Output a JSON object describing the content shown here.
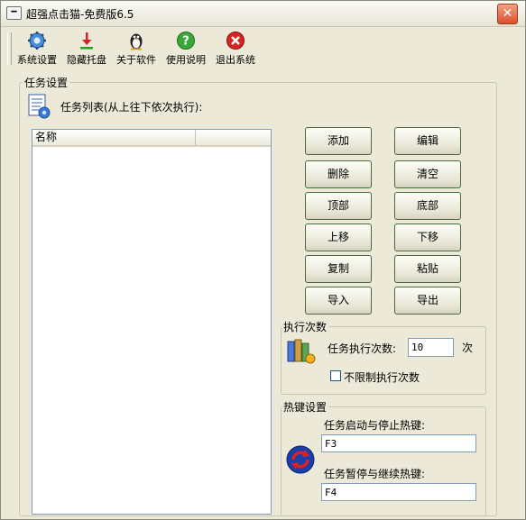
{
  "window": {
    "title": "超强点击猫-免费版6.5",
    "sysmenu_glyph": "━",
    "close_glyph": "✕"
  },
  "toolbar": {
    "items": [
      {
        "label": "系统设置",
        "icon": "gear-icon"
      },
      {
        "label": "隐藏托盘",
        "icon": "download-icon"
      },
      {
        "label": "关于软件",
        "icon": "penguin-icon"
      },
      {
        "label": "使用说明",
        "icon": "help-icon"
      },
      {
        "label": "退出系统",
        "icon": "exit-icon"
      }
    ]
  },
  "task_settings": {
    "title": "任务设置",
    "list_caption": "任务列表(从上往下依次执行):",
    "list_columns": [
      "名称",
      ""
    ],
    "buttons": {
      "add": "添加",
      "edit": "编辑",
      "delete": "删除",
      "clear": "清空",
      "top": "顶部",
      "bottom": "底部",
      "up": "上移",
      "down": "下移",
      "copy": "复制",
      "paste": "粘贴",
      "import": "导入",
      "export": "导出"
    }
  },
  "exec_count": {
    "title": "执行次数",
    "label": "任务执行次数:",
    "value": "10",
    "unit": "次",
    "unlimited_label": "不限制执行次数",
    "unlimited_checked": false
  },
  "hotkeys": {
    "title": "热键设置",
    "start_stop_label": "任务启动与停止热键:",
    "start_stop_value": "F3",
    "pause_resume_label": "任务暂停与继续热键:",
    "pause_resume_value": "F4"
  },
  "colors": {
    "window_bg": "#ece9d8",
    "close_red": "#d9502c",
    "button_border": "#4a6a3a",
    "input_border": "#7f9db9"
  }
}
